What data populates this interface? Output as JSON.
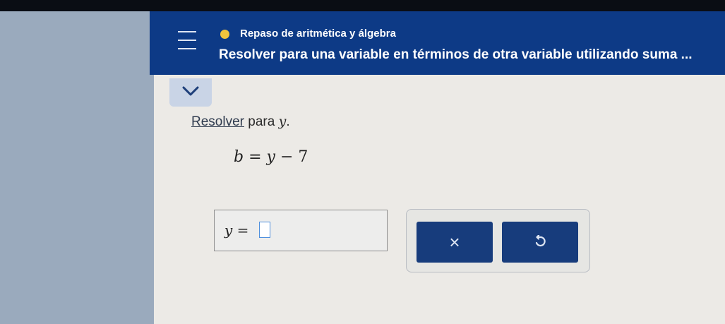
{
  "header": {
    "subject": "Repaso de aritmética y álgebra",
    "topic": "Resolver para una variable en términos de otra variable utilizando suma ...",
    "colors": {
      "background": "#0d3a86",
      "status_dot": "#f2c53d"
    }
  },
  "icons": {
    "menu": "hamburger-menu-icon",
    "status": "status-dot-icon",
    "collapse": "chevron-down-icon",
    "clear": "close-icon",
    "undo": "undo-icon"
  },
  "problem": {
    "instruction_link": "Resolver",
    "instruction_text": " para ",
    "instruction_var": "y",
    "instruction_end": ".",
    "equation": {
      "lhs": "b",
      "equals": " = ",
      "var": "y",
      "minus": " − ",
      "constant": "7"
    }
  },
  "answer": {
    "label_var": "y",
    "label_equals": " =",
    "value": ""
  },
  "controls": {
    "clear_symbol": "×"
  }
}
